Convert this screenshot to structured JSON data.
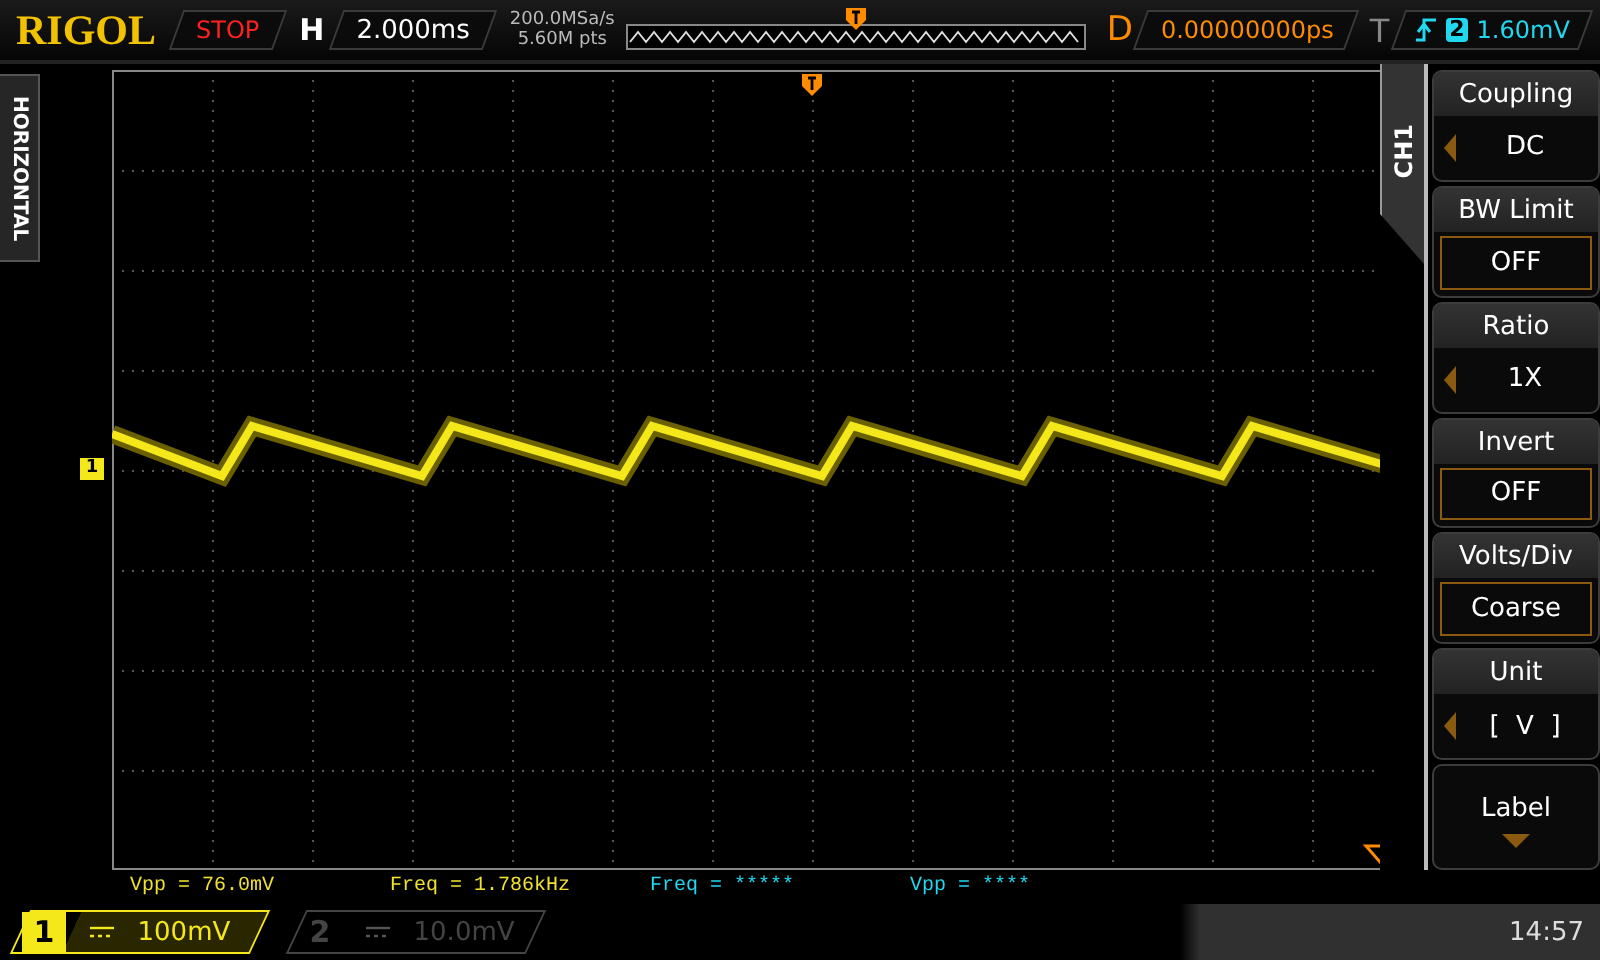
{
  "header": {
    "logo": "RIGOL",
    "run_state": "STOP",
    "h_label": "H",
    "timebase": "2.000ms",
    "sample_rate": "200.0MSa/s",
    "memory_depth": "5.60M pts",
    "d_label": "D",
    "delay": "0.00000000ps",
    "t_label": "T",
    "trigger_source": "2",
    "trigger_level": "1.60mV"
  },
  "side_label": "HORIZONTAL",
  "channel_marker": "1",
  "menu": {
    "title": "CH1",
    "items": [
      {
        "label": "Coupling",
        "value": "DC",
        "kind": "select"
      },
      {
        "label": "BW Limit",
        "value": "OFF",
        "kind": "toggle"
      },
      {
        "label": "Ratio",
        "value": "1X",
        "kind": "select"
      },
      {
        "label": "Invert",
        "value": "OFF",
        "kind": "toggle"
      },
      {
        "label": "Volts/Div",
        "value": "Coarse",
        "kind": "toggle"
      },
      {
        "label": "Unit",
        "value": "[  V  ]",
        "kind": "select"
      },
      {
        "label": "Label",
        "kind": "submenu"
      }
    ]
  },
  "measurements": [
    {
      "text": "Vpp = 76.0mV",
      "color": "#f0e030"
    },
    {
      "text": "Freq = 1.786kHz",
      "color": "#f0e030"
    },
    {
      "text": "Freq = *****",
      "color": "#20d8f0"
    },
    {
      "text": "Vpp = ****",
      "color": "#20d8f0"
    }
  ],
  "channels": [
    {
      "number": "1",
      "scale": "100mV",
      "on": true
    },
    {
      "number": "2",
      "scale": "10.0mV",
      "on": false
    }
  ],
  "clock": "14:57"
}
